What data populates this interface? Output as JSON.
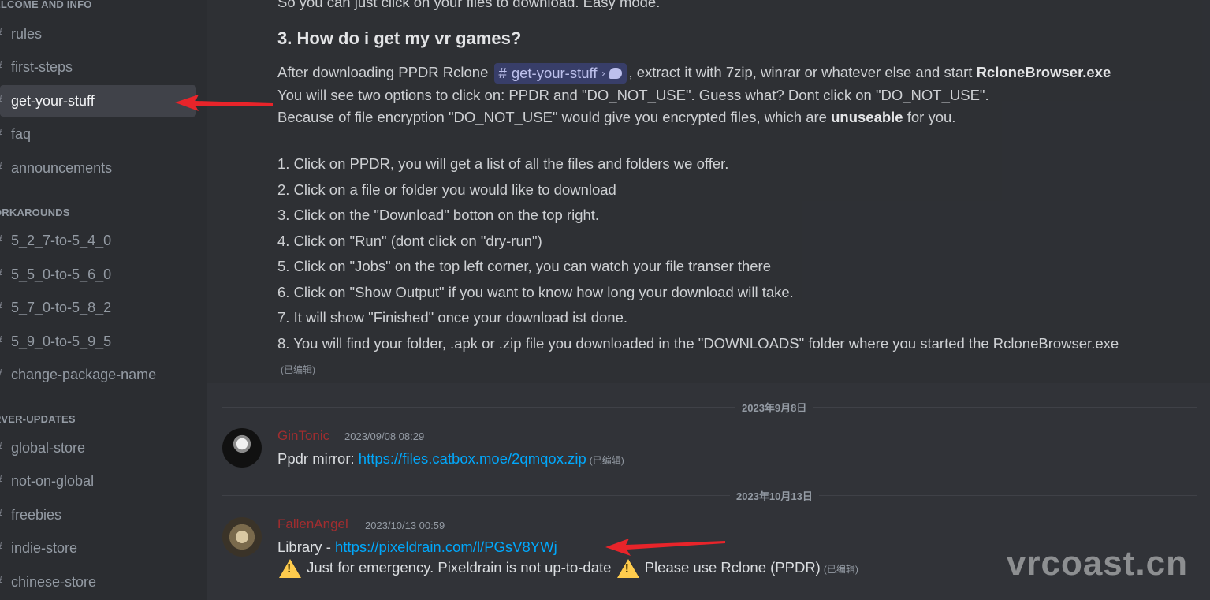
{
  "sidebar": {
    "categories": {
      "welcome": "ELCOME AND INFO",
      "workarounds": "ORKAROUNDS",
      "server_updates": "RVER-UPDATES"
    },
    "channels": {
      "rules": "rules",
      "first_steps": "first-steps",
      "get_your_stuff": "get-your-stuff",
      "faq": "faq",
      "announcements": "announcements",
      "w1": "5_2_7-to-5_4_0",
      "w2": "5_5_0-to-5_6_0",
      "w3": "5_7_0-to-5_8_2",
      "w4": "5_9_0-to-5_9_5",
      "change_package": "change-package-name",
      "global_store": "global-store",
      "not_on_global": "not-on-global",
      "freebies": "freebies",
      "indie_store": "indie-store",
      "chinese_store": "chinese-store"
    }
  },
  "message": {
    "top_cut": "So you can just click on your files to download. Easy mode.",
    "heading": "3. How do i get my vr games?",
    "p1_before": "After downloading PPDR Rclone ",
    "mention_hash": "#",
    "mention_name": "get-your-stuff",
    "mention_sep": "›",
    "p1_after": ", extract it with 7zip, winrar or whatever else and start ",
    "p1_bold": "RcloneBrowser.exe",
    "p2": "You will see two options to click on: PPDR and \"DO_NOT_USE\". Guess what? Dont click on \"DO_NOT_USE\".",
    "p3_before": "Because of file encryption \"DO_NOT_USE\" would give you encrypted files, which are ",
    "p3_bold": "unuseable",
    "p3_after": " for you.",
    "steps": [
      "1. Click on PPDR, you will get a list of all the files and folders we offer.",
      "2. Click on a file or folder you would like to download",
      "3. Click on the \"Download\" botton on the top right.",
      "4. Click on \"Run\" (dont click on \"dry-run\")",
      "5. Click on \"Jobs\" on the top left corner, you can watch your file transer there",
      "6. Click on \"Show Output\" if you want to know how long your download will take.",
      "7. It will show \"Finished\" once your download ist done.",
      "8. You will find your folder, .apk or .zip file you downloaded in the \"DOWNLOADS\" folder where you started the RcloneBrowser.exe"
    ],
    "edited": "(已编辑)"
  },
  "dividers": {
    "d1": "2023年9月8日",
    "d2": "2023年10月13日"
  },
  "posts": {
    "gin": {
      "username": "GinTonic",
      "timestamp": "2023/09/08 08:29",
      "prefix": "Ppdr  mirror: ",
      "link": "https://files.catbox.moe/2qmqox.zip",
      "edited": "(已编辑)"
    },
    "fallen": {
      "username": "FallenAngel",
      "timestamp": "2023/10/13 00:59",
      "line1_prefix": "Library - ",
      "link": "https://pixeldrain.com/l/PGsV8YWj",
      "warn1": "Just for emergency. Pixeldrain is not up-to-date",
      "warn2": "Please use Rclone (PPDR)",
      "edited": "(已编辑)"
    }
  },
  "watermark": "vrcoast.cn",
  "colors": {
    "background": "#313338",
    "sidebar": "#2b2d31",
    "username": "#a12d2f",
    "link": "#00a8fc",
    "arrow": "#e8242a"
  }
}
